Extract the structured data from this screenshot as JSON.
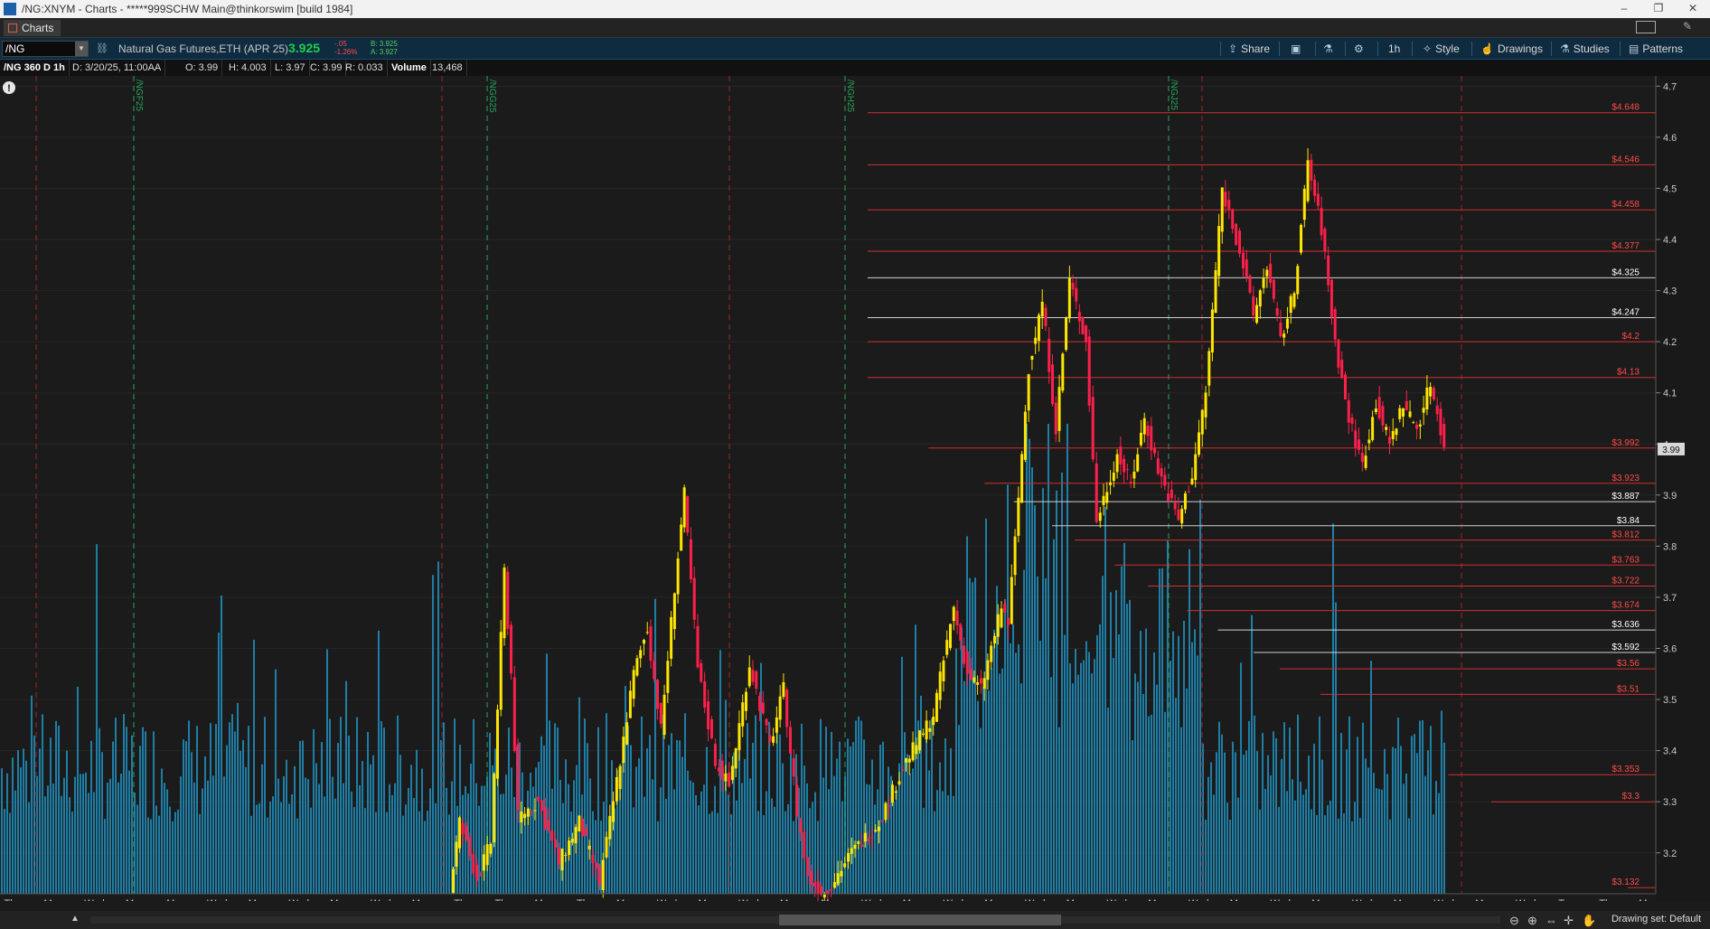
{
  "window": {
    "title": "/NG:XNYM - Charts - *****999SCHW Main@thinkorswim [build 1984]",
    "minimize": "–",
    "maximize": "❐",
    "close": "✕"
  },
  "tab": {
    "label": "Charts"
  },
  "toolbar": {
    "symbol": "/NG",
    "description": "Natural Gas Futures,ETH (APR 25)",
    "last": "3.925",
    "change": "-.05",
    "change_pct": "-1.26%",
    "bid": "B: 3.925",
    "ask": "A: 3.927",
    "share": "Share",
    "timeframe": "1h",
    "style": "Style",
    "drawings": "Drawings",
    "studies": "Studies",
    "patterns": "Patterns",
    "colors": {
      "background": "#0f2b40",
      "last": "#1bd14b",
      "change": "#ff4a4a",
      "bidask": "#56d056"
    }
  },
  "infobar": {
    "aggregation": "/NG 360 D 1h",
    "date": "D: 3/20/25, 11:00AA",
    "open": "O: 3.99",
    "high": "H: 4.003",
    "low": "L: 3.97",
    "close": "C: 3.99",
    "range": "R: 0.033",
    "volume_label": "Volume",
    "volume_value": "13,468"
  },
  "chart_data": {
    "type": "candlestick",
    "ylim": [
      3.12,
      4.72
    ],
    "y_ticks": [
      3.2,
      3.3,
      3.4,
      3.5,
      3.6,
      3.7,
      3.8,
      3.9,
      4.0,
      4.1,
      4.2,
      4.3,
      4.4,
      4.5,
      4.6,
      4.7
    ],
    "y_tick_labels": [
      "3.2",
      "3.3",
      "3.4",
      "3.5",
      "3.6",
      "3.7",
      "3.8",
      "3.9",
      "4",
      "4.1",
      "4.2",
      "4.3",
      "4.4",
      "4.5",
      "4.6",
      "4.7"
    ],
    "last_price_label": "3.99",
    "last_price": 3.99,
    "x_labels": [
      "Thu",
      "Mon",
      "Wed",
      "Mon",
      "Mon",
      "Wed",
      "Mon",
      "Wed",
      "Mon",
      "Wed",
      "Mon",
      "Thu",
      "Thu",
      "Mon",
      "Thu",
      "Mon",
      "Wed",
      "Mon",
      "Wed",
      "Mon",
      "Mon",
      "Wed",
      "Mon",
      "Wed",
      "Mon",
      "Wed",
      "Mon",
      "Wed",
      "Mon",
      "Wed",
      "Mon",
      "Wed",
      "Mon",
      "Wed",
      "Mon",
      "Wed",
      "Mon",
      "Wed",
      "Tue",
      "Thu",
      "Mon"
    ],
    "expiration_labels": [
      "/NGF25",
      "/NGG25",
      "/NGH25",
      "/NGJ25"
    ],
    "price_levels": [
      {
        "label": "$4.648",
        "value": 4.648,
        "kind": "red"
      },
      {
        "label": "$4.546",
        "value": 4.546,
        "kind": "red"
      },
      {
        "label": "$4.458",
        "value": 4.458,
        "kind": "red"
      },
      {
        "label": "$4.377",
        "value": 4.377,
        "kind": "red"
      },
      {
        "label": "$4.325",
        "value": 4.325,
        "kind": "white"
      },
      {
        "label": "$4.247",
        "value": 4.247,
        "kind": "white"
      },
      {
        "label": "$4.2",
        "value": 4.2,
        "kind": "red"
      },
      {
        "label": "$4.13",
        "value": 4.13,
        "kind": "red"
      },
      {
        "label": "$3.992",
        "value": 3.992,
        "kind": "red"
      },
      {
        "label": "$3.923",
        "value": 3.923,
        "kind": "red"
      },
      {
        "label": "$3.887",
        "value": 3.887,
        "kind": "white"
      },
      {
        "label": "$3.84",
        "value": 3.84,
        "kind": "white"
      },
      {
        "label": "$3.812",
        "value": 3.812,
        "kind": "red"
      },
      {
        "label": "$3.763",
        "value": 3.763,
        "kind": "red"
      },
      {
        "label": "$3.722",
        "value": 3.722,
        "kind": "red"
      },
      {
        "label": "$3.674",
        "value": 3.674,
        "kind": "red"
      },
      {
        "label": "$3.636",
        "value": 3.636,
        "kind": "white"
      },
      {
        "label": "$3.592",
        "value": 3.592,
        "kind": "white"
      },
      {
        "label": "$3.56",
        "value": 3.56,
        "kind": "red"
      },
      {
        "label": "$3.51",
        "value": 3.51,
        "kind": "red"
      },
      {
        "label": "$3.353",
        "value": 3.353,
        "kind": "red"
      },
      {
        "label": "$3.3",
        "value": 3.3,
        "kind": "red"
      },
      {
        "label": "$3.132",
        "value": 3.132,
        "kind": "red"
      }
    ],
    "price_path": [
      [
        0.265,
        3.13
      ],
      [
        0.272,
        3.26
      ],
      [
        0.285,
        3.15
      ],
      [
        0.295,
        3.22
      ],
      [
        0.305,
        3.75
      ],
      [
        0.31,
        3.55
      ],
      [
        0.315,
        3.27
      ],
      [
        0.33,
        3.3
      ],
      [
        0.345,
        3.18
      ],
      [
        0.36,
        3.26
      ],
      [
        0.375,
        3.14
      ],
      [
        0.39,
        3.38
      ],
      [
        0.4,
        3.55
      ],
      [
        0.41,
        3.64
      ],
      [
        0.42,
        3.44
      ],
      [
        0.43,
        3.72
      ],
      [
        0.437,
        3.9
      ],
      [
        0.447,
        3.56
      ],
      [
        0.46,
        3.38
      ],
      [
        0.47,
        3.33
      ],
      [
        0.485,
        3.57
      ],
      [
        0.5,
        3.41
      ],
      [
        0.51,
        3.52
      ],
      [
        0.52,
        3.28
      ],
      [
        0.528,
        3.15
      ],
      [
        0.54,
        3.12
      ],
      [
        0.56,
        3.2
      ],
      [
        0.58,
        3.26
      ],
      [
        0.6,
        3.38
      ],
      [
        0.62,
        3.47
      ],
      [
        0.635,
        3.68
      ],
      [
        0.645,
        3.55
      ],
      [
        0.655,
        3.52
      ],
      [
        0.67,
        3.68
      ],
      [
        0.675,
        3.65
      ],
      [
        0.68,
        3.81
      ],
      [
        0.69,
        4.15
      ],
      [
        0.7,
        4.28
      ],
      [
        0.71,
        4.03
      ],
      [
        0.72,
        4.32
      ],
      [
        0.732,
        4.2
      ],
      [
        0.74,
        3.85
      ],
      [
        0.755,
        3.98
      ],
      [
        0.765,
        3.92
      ],
      [
        0.775,
        4.05
      ],
      [
        0.785,
        3.95
      ],
      [
        0.8,
        3.85
      ],
      [
        0.81,
        3.94
      ],
      [
        0.82,
        4.1
      ],
      [
        0.832,
        4.5
      ],
      [
        0.845,
        4.38
      ],
      [
        0.855,
        4.25
      ],
      [
        0.865,
        4.35
      ],
      [
        0.875,
        4.2
      ],
      [
        0.885,
        4.3
      ],
      [
        0.895,
        4.55
      ],
      [
        0.905,
        4.42
      ],
      [
        0.915,
        4.2
      ],
      [
        0.925,
        4.05
      ],
      [
        0.935,
        3.96
      ],
      [
        0.945,
        4.08
      ],
      [
        0.955,
        4.0
      ],
      [
        0.965,
        4.08
      ],
      [
        0.975,
        4.03
      ],
      [
        0.985,
        4.12
      ],
      [
        0.995,
        4.0
      ]
    ],
    "colors": {
      "up": "#ffe600",
      "down": "#ff1f4b",
      "volume": "#1f7ea6",
      "volume_top": "#33a8d6",
      "level_red": "#d03030",
      "level_white": "#d0d0d0",
      "label_red": "#ff4a4a",
      "label_white": "#ffffff",
      "expiry_line": "#26a65b",
      "session_line": "#a02525",
      "grid": "#262626"
    }
  },
  "bottom": {
    "drawing_set": "Drawing set: Default"
  }
}
